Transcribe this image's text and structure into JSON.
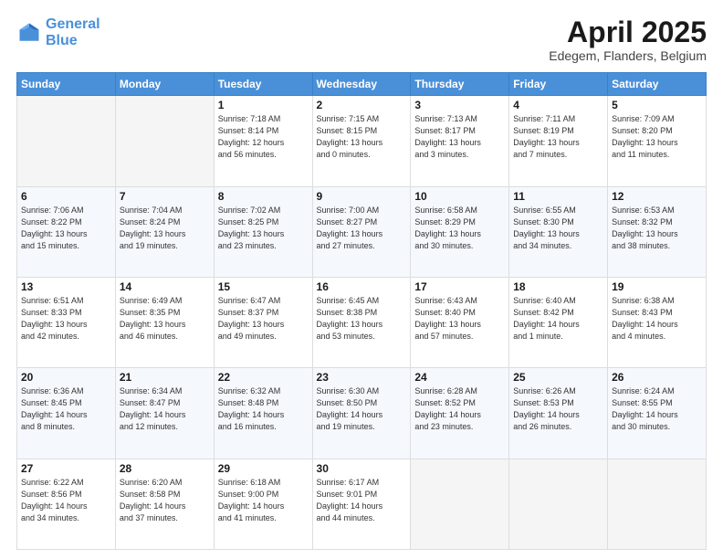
{
  "header": {
    "logo_line1": "General",
    "logo_line2": "Blue",
    "title": "April 2025",
    "subtitle": "Edegem, Flanders, Belgium"
  },
  "days_of_week": [
    "Sunday",
    "Monday",
    "Tuesday",
    "Wednesday",
    "Thursday",
    "Friday",
    "Saturday"
  ],
  "weeks": [
    [
      {
        "day": "",
        "info": ""
      },
      {
        "day": "",
        "info": ""
      },
      {
        "day": "1",
        "info": "Sunrise: 7:18 AM\nSunset: 8:14 PM\nDaylight: 12 hours\nand 56 minutes."
      },
      {
        "day": "2",
        "info": "Sunrise: 7:15 AM\nSunset: 8:15 PM\nDaylight: 13 hours\nand 0 minutes."
      },
      {
        "day": "3",
        "info": "Sunrise: 7:13 AM\nSunset: 8:17 PM\nDaylight: 13 hours\nand 3 minutes."
      },
      {
        "day": "4",
        "info": "Sunrise: 7:11 AM\nSunset: 8:19 PM\nDaylight: 13 hours\nand 7 minutes."
      },
      {
        "day": "5",
        "info": "Sunrise: 7:09 AM\nSunset: 8:20 PM\nDaylight: 13 hours\nand 11 minutes."
      }
    ],
    [
      {
        "day": "6",
        "info": "Sunrise: 7:06 AM\nSunset: 8:22 PM\nDaylight: 13 hours\nand 15 minutes."
      },
      {
        "day": "7",
        "info": "Sunrise: 7:04 AM\nSunset: 8:24 PM\nDaylight: 13 hours\nand 19 minutes."
      },
      {
        "day": "8",
        "info": "Sunrise: 7:02 AM\nSunset: 8:25 PM\nDaylight: 13 hours\nand 23 minutes."
      },
      {
        "day": "9",
        "info": "Sunrise: 7:00 AM\nSunset: 8:27 PM\nDaylight: 13 hours\nand 27 minutes."
      },
      {
        "day": "10",
        "info": "Sunrise: 6:58 AM\nSunset: 8:29 PM\nDaylight: 13 hours\nand 30 minutes."
      },
      {
        "day": "11",
        "info": "Sunrise: 6:55 AM\nSunset: 8:30 PM\nDaylight: 13 hours\nand 34 minutes."
      },
      {
        "day": "12",
        "info": "Sunrise: 6:53 AM\nSunset: 8:32 PM\nDaylight: 13 hours\nand 38 minutes."
      }
    ],
    [
      {
        "day": "13",
        "info": "Sunrise: 6:51 AM\nSunset: 8:33 PM\nDaylight: 13 hours\nand 42 minutes."
      },
      {
        "day": "14",
        "info": "Sunrise: 6:49 AM\nSunset: 8:35 PM\nDaylight: 13 hours\nand 46 minutes."
      },
      {
        "day": "15",
        "info": "Sunrise: 6:47 AM\nSunset: 8:37 PM\nDaylight: 13 hours\nand 49 minutes."
      },
      {
        "day": "16",
        "info": "Sunrise: 6:45 AM\nSunset: 8:38 PM\nDaylight: 13 hours\nand 53 minutes."
      },
      {
        "day": "17",
        "info": "Sunrise: 6:43 AM\nSunset: 8:40 PM\nDaylight: 13 hours\nand 57 minutes."
      },
      {
        "day": "18",
        "info": "Sunrise: 6:40 AM\nSunset: 8:42 PM\nDaylight: 14 hours\nand 1 minute."
      },
      {
        "day": "19",
        "info": "Sunrise: 6:38 AM\nSunset: 8:43 PM\nDaylight: 14 hours\nand 4 minutes."
      }
    ],
    [
      {
        "day": "20",
        "info": "Sunrise: 6:36 AM\nSunset: 8:45 PM\nDaylight: 14 hours\nand 8 minutes."
      },
      {
        "day": "21",
        "info": "Sunrise: 6:34 AM\nSunset: 8:47 PM\nDaylight: 14 hours\nand 12 minutes."
      },
      {
        "day": "22",
        "info": "Sunrise: 6:32 AM\nSunset: 8:48 PM\nDaylight: 14 hours\nand 16 minutes."
      },
      {
        "day": "23",
        "info": "Sunrise: 6:30 AM\nSunset: 8:50 PM\nDaylight: 14 hours\nand 19 minutes."
      },
      {
        "day": "24",
        "info": "Sunrise: 6:28 AM\nSunset: 8:52 PM\nDaylight: 14 hours\nand 23 minutes."
      },
      {
        "day": "25",
        "info": "Sunrise: 6:26 AM\nSunset: 8:53 PM\nDaylight: 14 hours\nand 26 minutes."
      },
      {
        "day": "26",
        "info": "Sunrise: 6:24 AM\nSunset: 8:55 PM\nDaylight: 14 hours\nand 30 minutes."
      }
    ],
    [
      {
        "day": "27",
        "info": "Sunrise: 6:22 AM\nSunset: 8:56 PM\nDaylight: 14 hours\nand 34 minutes."
      },
      {
        "day": "28",
        "info": "Sunrise: 6:20 AM\nSunset: 8:58 PM\nDaylight: 14 hours\nand 37 minutes."
      },
      {
        "day": "29",
        "info": "Sunrise: 6:18 AM\nSunset: 9:00 PM\nDaylight: 14 hours\nand 41 minutes."
      },
      {
        "day": "30",
        "info": "Sunrise: 6:17 AM\nSunset: 9:01 PM\nDaylight: 14 hours\nand 44 minutes."
      },
      {
        "day": "",
        "info": ""
      },
      {
        "day": "",
        "info": ""
      },
      {
        "day": "",
        "info": ""
      }
    ]
  ]
}
